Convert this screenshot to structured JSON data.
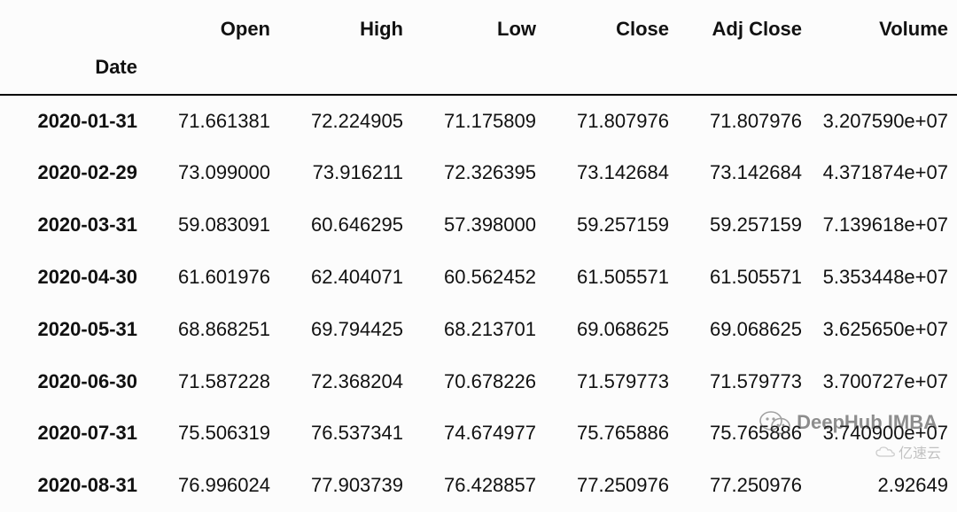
{
  "table": {
    "index_label": "Date",
    "columns": [
      "Open",
      "High",
      "Low",
      "Close",
      "Adj Close",
      "Volume"
    ],
    "rows": [
      {
        "date": "2020-01-31",
        "open": "71.661381",
        "high": "72.224905",
        "low": "71.175809",
        "close": "71.807976",
        "adj": "71.807976",
        "volume": "3.207590e+07"
      },
      {
        "date": "2020-02-29",
        "open": "73.099000",
        "high": "73.916211",
        "low": "72.326395",
        "close": "73.142684",
        "adj": "73.142684",
        "volume": "4.371874e+07"
      },
      {
        "date": "2020-03-31",
        "open": "59.083091",
        "high": "60.646295",
        "low": "57.398000",
        "close": "59.257159",
        "adj": "59.257159",
        "volume": "7.139618e+07"
      },
      {
        "date": "2020-04-30",
        "open": "61.601976",
        "high": "62.404071",
        "low": "60.562452",
        "close": "61.505571",
        "adj": "61.505571",
        "volume": "5.353448e+07"
      },
      {
        "date": "2020-05-31",
        "open": "68.868251",
        "high": "69.794425",
        "low": "68.213701",
        "close": "69.068625",
        "adj": "69.068625",
        "volume": "3.625650e+07"
      },
      {
        "date": "2020-06-30",
        "open": "71.587228",
        "high": "72.368204",
        "low": "70.678226",
        "close": "71.579773",
        "adj": "71.579773",
        "volume": "3.700727e+07"
      },
      {
        "date": "2020-07-31",
        "open": "75.506319",
        "high": "76.537341",
        "low": "74.674977",
        "close": "75.765886",
        "adj": "75.765886",
        "volume": "3.740900e+07"
      },
      {
        "date": "2020-08-31",
        "open": "76.996024",
        "high": "77.903739",
        "low": "76.428857",
        "close": "77.250976",
        "adj": "77.250976",
        "volume": "2.92649"
      }
    ]
  },
  "watermark": {
    "text": "DeepHub IMBA"
  },
  "watermark2": {
    "text": "亿速云"
  }
}
